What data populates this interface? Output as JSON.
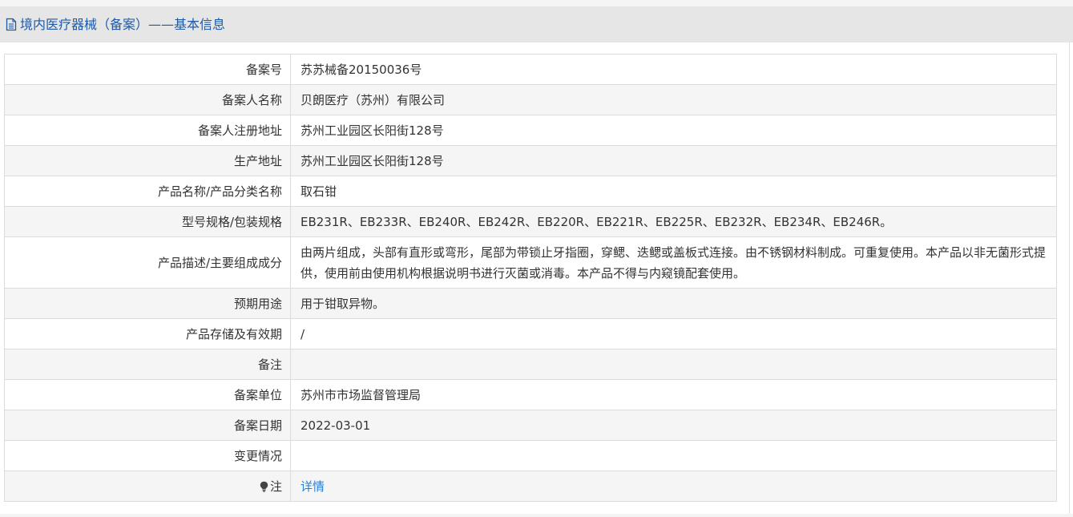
{
  "header": {
    "icon": "document-icon",
    "title": "境内医疗器械（备案）——基本信息"
  },
  "rows": [
    {
      "label": "备案号",
      "value": "苏苏械备20150036号"
    },
    {
      "label": "备案人名称",
      "value": "贝朗医疗（苏州）有限公司"
    },
    {
      "label": "备案人注册地址",
      "value": "苏州工业园区长阳街128号"
    },
    {
      "label": "生产地址",
      "value": "苏州工业园区长阳街128号"
    },
    {
      "label": "产品名称/产品分类名称",
      "value": "取石钳"
    },
    {
      "label": "型号规格/包装规格",
      "value": "EB231R、EB233R、EB240R、EB242R、EB220R、EB221R、EB225R、EB232R、EB234R、EB246R。"
    },
    {
      "label": "产品描述/主要组成成分",
      "value": "由两片组成，头部有直形或弯形，尾部为带锁止牙指圈，穿鳃、迭鳃或盖板式连接。由不锈钢材料制成。可重复使用。本产品以非无菌形式提供，使用前由使用机构根据说明书进行灭菌或消毒。本产品不得与内窥镜配套使用。"
    },
    {
      "label": "预期用途",
      "value": "用于钳取异物。"
    },
    {
      "label": "产品存储及有效期",
      "value": "/"
    },
    {
      "label": "备注",
      "value": ""
    },
    {
      "label": "备案单位",
      "value": "苏州市市场监督管理局"
    },
    {
      "label": "备案日期",
      "value": "2022-03-01"
    },
    {
      "label": "变更情况",
      "value": ""
    },
    {
      "label": "注",
      "value": "详情",
      "label_icon": "lightbulb-icon"
    }
  ],
  "colors": {
    "header_bg": "#e6e6e6",
    "title": "#1e5aa8",
    "link": "#2a7fd4",
    "row_alt": "#f5f5f5",
    "border": "#dcdcdc"
  }
}
